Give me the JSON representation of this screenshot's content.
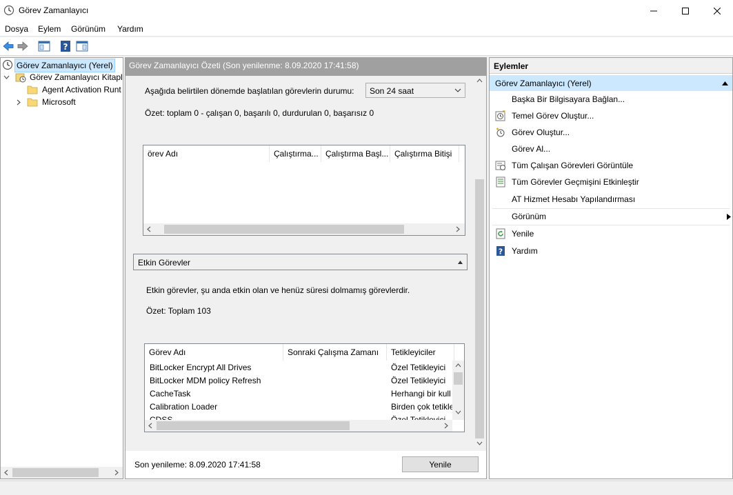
{
  "window": {
    "title": "Görev Zamanlayıcı",
    "icon": "clock-icon"
  },
  "menu": [
    "Dosya",
    "Eylem",
    "Görünüm",
    "Yardım"
  ],
  "tree": {
    "items": [
      {
        "label": "Görev Zamanlayıcı (Yerel)",
        "icon": "clock-icon",
        "selected": true
      },
      {
        "label": "Görev Zamanlayıcı Kitaplı",
        "icon": "library-icon",
        "expanded": true
      },
      {
        "label": "Agent Activation Runt",
        "icon": "folder-icon"
      },
      {
        "label": "Microsoft",
        "icon": "folder-icon",
        "collapsed": true
      }
    ]
  },
  "center": {
    "header": "Görev Zamanlayıcı Özeti (Son yenilenme: 8.09.2020 17:41:58)",
    "status_prompt": "Aşağıda belirtilen dönemde başlatılan görevlerin durumu:",
    "period_select": "Son 24 saat",
    "summary": "Özet: toplam 0 - çalışan 0, başarılı 0, durdurulan 0, başarısız 0",
    "status_table": {
      "columns": [
        "örev Adı",
        "Çalıştırma...",
        "Çalıştırma Başl...",
        "Çalıştırma Bitişi"
      ]
    },
    "active_section": {
      "title": "Etkin Görevler",
      "description": "Etkin görevler, şu anda etkin olan ve henüz süresi dolmamış görevlerdir.",
      "summary": "Özet: Toplam 103",
      "table": {
        "columns": [
          "Görev Adı",
          "Sonraki Çalışma Zamanı",
          "Tetikleyiciler"
        ],
        "rows": [
          {
            "name": "BitLocker Encrypt All Drives",
            "next": "",
            "trigger": "Özel Tetikleyici"
          },
          {
            "name": "BitLocker MDM policy Refresh",
            "next": "",
            "trigger": "Özel Tetikleyici"
          },
          {
            "name": "CacheTask",
            "next": "",
            "trigger": "Herhangi bir kull"
          },
          {
            "name": "Calibration Loader",
            "next": "",
            "trigger": "Birden çok tetikle"
          },
          {
            "name": "CDSS",
            "next": "",
            "trigger": "Özel Tetikleyici"
          }
        ]
      }
    },
    "footer": {
      "last_refresh": "Son yenileme: 8.09.2020 17:41:58",
      "refresh_button": "Yenile"
    }
  },
  "actions": {
    "title": "Eylemler",
    "subtitle": "Görev Zamanlayıcı (Yerel)",
    "items": [
      {
        "label": "Başka Bir Bilgisayara Bağlan...",
        "icon": ""
      },
      {
        "label": "Temel Görev Oluştur...",
        "icon": "wizard-icon"
      },
      {
        "label": "Görev Oluştur...",
        "icon": "create-task-icon"
      },
      {
        "label": "Görev Al...",
        "icon": ""
      },
      {
        "label": "Tüm Çalışan Görevleri Görüntüle",
        "icon": "running-tasks-icon"
      },
      {
        "label": "Tüm Görevler Geçmişini Etkinleştir",
        "icon": "history-icon"
      },
      {
        "label": "AT Hizmet Hesabı Yapılandırması",
        "icon": ""
      },
      {
        "label": "Görünüm",
        "icon": "",
        "submenu": true
      },
      {
        "label": "Yenile",
        "icon": "refresh-icon"
      },
      {
        "label": "Yardım",
        "icon": "help-icon"
      }
    ]
  },
  "colors": {
    "selection": "#cce8ff",
    "header_gray": "#a0a0a0",
    "help_blue": "#2b5797"
  }
}
